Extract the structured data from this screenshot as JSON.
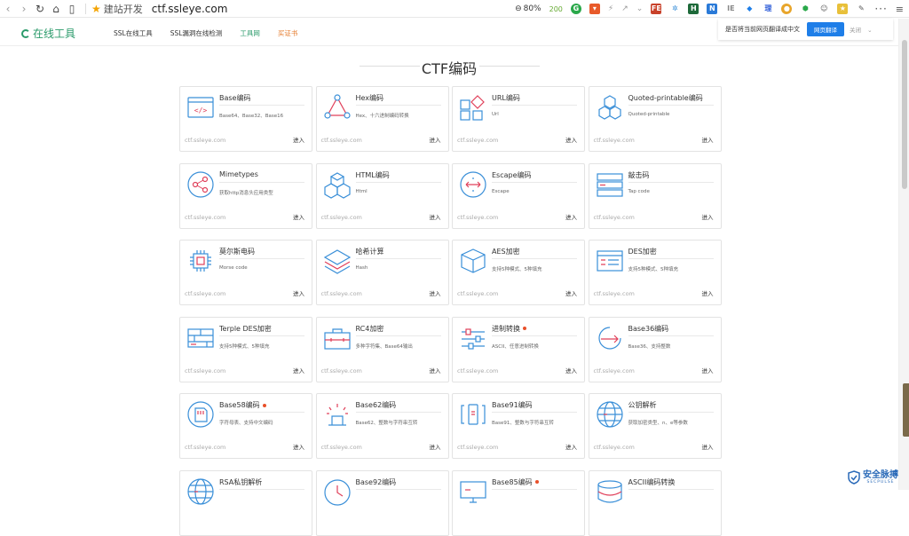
{
  "browser": {
    "bookmark_label": "建站开发",
    "url": "ctf.ssleye.com",
    "zoom": "80%",
    "ext_count": "200",
    "more": "···"
  },
  "site": {
    "logo": "在线工具",
    "nav": [
      {
        "label": "SSL在线工具",
        "style": ""
      },
      {
        "label": "SSL漏洞在线检测",
        "style": ""
      },
      {
        "label": "工具网",
        "style": "green"
      },
      {
        "label": "买证书",
        "style": "orange"
      }
    ],
    "translate": {
      "prompt": "是否将当前网页翻译成中文",
      "button": "网页翻译",
      "close": "关闭"
    }
  },
  "section_title": "CTF编码",
  "cards": [
    {
      "name": "Base编码",
      "desc": "Base64、Base32、Base16",
      "site": "ctf.ssleye.com",
      "enter": "进入",
      "icon": "code-window-icon",
      "dot": false
    },
    {
      "name": "Hex编码",
      "desc": "Hex、十六进制编码转换",
      "site": "ctf.ssleye.com",
      "enter": "进入",
      "icon": "triangle-nodes-icon",
      "dot": false
    },
    {
      "name": "URL编码",
      "desc": "Url",
      "site": "ctf.ssleye.com",
      "enter": "进入",
      "icon": "url-blocks-icon",
      "dot": false
    },
    {
      "name": "Quoted-printable编码",
      "desc": "Quoted-printable",
      "site": "ctf.ssleye.com",
      "enter": "进入",
      "icon": "hexagons-icon",
      "dot": false
    },
    {
      "name": "Mimetypes",
      "desc": "获取http消息头应用类型",
      "site": "ctf.ssleye.com",
      "enter": "进入",
      "icon": "share-circle-icon",
      "dot": false
    },
    {
      "name": "HTML编码",
      "desc": "Html",
      "site": "ctf.ssleye.com",
      "enter": "进入",
      "icon": "cubes-icon",
      "dot": false
    },
    {
      "name": "Escape编码",
      "desc": "Escape",
      "site": "ctf.ssleye.com",
      "enter": "进入",
      "icon": "arrows-circle-icon",
      "dot": false
    },
    {
      "name": "敲击码",
      "desc": "Tap code",
      "site": "ctf.ssleye.com",
      "enter": "进入",
      "icon": "stack-window-icon",
      "dot": false
    },
    {
      "name": "莫尔斯电码",
      "desc": "Morse code",
      "site": "ctf.ssleye.com",
      "enter": "进入",
      "icon": "chip-icon",
      "dot": false
    },
    {
      "name": "哈希计算",
      "desc": "Hash",
      "site": "ctf.ssleye.com",
      "enter": "进入",
      "icon": "layers-icon",
      "dot": false
    },
    {
      "name": "AES加密",
      "desc": "支持5种模式、5种填充",
      "site": "ctf.ssleye.com",
      "enter": "进入",
      "icon": "box-icon",
      "dot": false
    },
    {
      "name": "DES加密",
      "desc": "支持5种模式、5种填充",
      "site": "ctf.ssleye.com",
      "enter": "进入",
      "icon": "form-window-icon",
      "dot": false
    },
    {
      "name": "Terple DES加密",
      "desc": "支持5种模式、5种填充",
      "site": "ctf.ssleye.com",
      "enter": "进入",
      "icon": "grid-panel-icon",
      "dot": false
    },
    {
      "name": "RC4加密",
      "desc": "多种字符集、Base64输出",
      "site": "ctf.ssleye.com",
      "enter": "进入",
      "icon": "toolbox-icon",
      "dot": false
    },
    {
      "name": "进制转换",
      "desc": "ASCII、任意进制转换",
      "site": "ctf.ssleye.com",
      "enter": "进入",
      "icon": "sliders-icon",
      "dot": true
    },
    {
      "name": "Base36编码",
      "desc": "Base36、支持整数",
      "site": "ctf.ssleye.com",
      "enter": "进入",
      "icon": "arrow-circle-icon",
      "dot": false
    },
    {
      "name": "Base58编码",
      "desc": "字符母表、支持中文编码",
      "site": "ctf.ssleye.com",
      "enter": "进入",
      "icon": "sd-card-icon",
      "dot": true
    },
    {
      "name": "Base62编码",
      "desc": "Base62、整数与字符串互转",
      "site": "ctf.ssleye.com",
      "enter": "进入",
      "icon": "lamp-icon",
      "dot": false
    },
    {
      "name": "Base91编码",
      "desc": "Base91、整数与字符串互转",
      "site": "ctf.ssleye.com",
      "enter": "进入",
      "icon": "phone-brackets-icon",
      "dot": false
    },
    {
      "name": "公钥解析",
      "desc": "获取加密类型、n、e等参数",
      "site": "ctf.ssleye.com",
      "enter": "进入",
      "icon": "globe-icon",
      "dot": false
    },
    {
      "name": "RSA私钥解析",
      "desc": "",
      "site": "",
      "enter": "",
      "icon": "globe-icon",
      "dot": false
    },
    {
      "name": "Base92编码",
      "desc": "",
      "site": "",
      "enter": "",
      "icon": "clock-icon",
      "dot": false
    },
    {
      "name": "Base85编码",
      "desc": "",
      "site": "",
      "enter": "",
      "icon": "monitor-icon",
      "dot": true
    },
    {
      "name": "ASCII编码转换",
      "desc": "",
      "site": "",
      "enter": "",
      "icon": "database-icon",
      "dot": false
    }
  ],
  "watermark": {
    "title": "安全脉搏",
    "sub": "SECPULSE"
  },
  "colors": {
    "accent": "#2a9a6a",
    "icon_stroke": "#3a8fd8",
    "icon_red": "#e0405a",
    "dot": "#e8502a",
    "translate_button": "#1e7ee8"
  }
}
